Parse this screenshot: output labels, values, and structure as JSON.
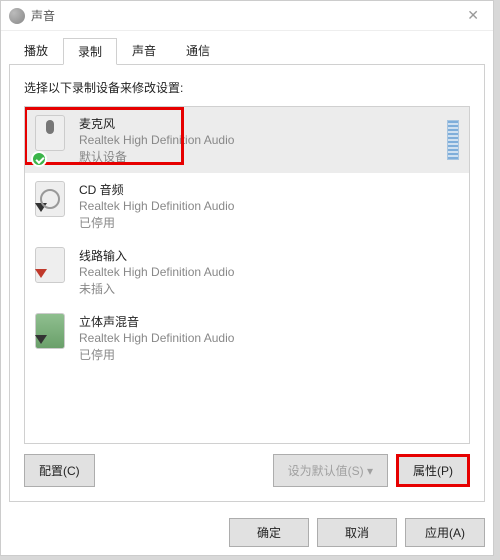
{
  "window": {
    "title": "声音"
  },
  "tabs": {
    "items": [
      {
        "label": "播放"
      },
      {
        "label": "录制"
      },
      {
        "label": "声音"
      },
      {
        "label": "通信"
      }
    ],
    "active_index": 1
  },
  "instruction": "选择以下录制设备来修改设置:",
  "devices": [
    {
      "name": "麦克风",
      "sub": "Realtek High Definition Audio",
      "status": "默认设备",
      "selected": true,
      "default": true,
      "icon": "mic",
      "meter": true
    },
    {
      "name": "CD 音频",
      "sub": "Realtek High Definition Audio",
      "status": "已停用",
      "icon": "cd"
    },
    {
      "name": "线路输入",
      "sub": "Realtek High Definition Audio",
      "status": "未插入",
      "icon": "linein"
    },
    {
      "name": "立体声混音",
      "sub": "Realtek High Definition Audio",
      "status": "已停用",
      "icon": "stereomix"
    }
  ],
  "buttons": {
    "configure": "配置(C)",
    "set_default": "设为默认值(S)",
    "properties": "属性(P)",
    "ok": "确定",
    "cancel": "取消",
    "apply": "应用(A)"
  },
  "highlight": {
    "selected_device": true,
    "properties_button": true
  }
}
